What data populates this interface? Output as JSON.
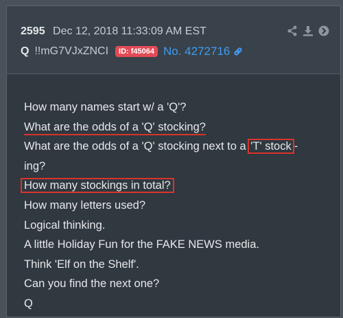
{
  "post": {
    "number": "2595",
    "date": "Dec 12, 2018 11:33:09 AM EST",
    "author": "Q",
    "tripcode": "!!mG7VJxZNCI",
    "id_badge": "ID: f45064",
    "post_link": "No. 4272716"
  },
  "icons": [
    "share-icon",
    "download-icon",
    "goto-icon",
    "link-icon"
  ],
  "colors": {
    "badge": "#e24b56",
    "link": "#3f9cf5",
    "highlight": "#d9342b"
  },
  "body": {
    "l1": "How many names start w/ a 'Q'?",
    "l2": "What are the odds of a 'Q' stocking?",
    "l3a": "What are the odds of a 'Q' stocking next to a ",
    "l3b": "'T' stock",
    "l3c": "-",
    "l4": "ing?",
    "l5": "How many stockings in total?",
    "l6": "How many letters used?",
    "l7": "Logical thinking.",
    "l8": "A little Holiday Fun for the FAKE NEWS media.",
    "l9": "Think 'Elf on the Shelf'.",
    "l10": "Can you find the next one?",
    "l11": "Q"
  }
}
